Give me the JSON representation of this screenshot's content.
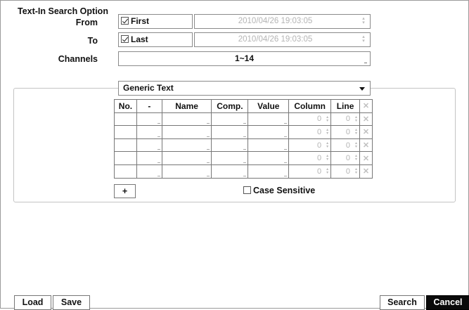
{
  "dialog": {
    "title": "Text-In Search Option"
  },
  "from": {
    "label": "From",
    "checkbox_label": "First",
    "checked": true,
    "datetime": "2010/04/26  19:03:05"
  },
  "to": {
    "label": "To",
    "checkbox_label": "Last",
    "checked": true,
    "datetime": "2010/04/26  19:03:05"
  },
  "channels": {
    "label": "Channels",
    "value": "1~14"
  },
  "device_type": {
    "selected": "Generic Text"
  },
  "table": {
    "headers": {
      "no": "No.",
      "dash": "-",
      "name": "Name",
      "comp": "Comp.",
      "value": "Value",
      "column": "Column",
      "line": "Line"
    },
    "rows": [
      {
        "column": "0",
        "line": "0"
      },
      {
        "column": "0",
        "line": "0"
      },
      {
        "column": "0",
        "line": "0"
      },
      {
        "column": "0",
        "line": "0"
      },
      {
        "column": "0",
        "line": "0"
      }
    ]
  },
  "add_button": {
    "label": "+"
  },
  "case_sensitive": {
    "label": "Case Sensitive",
    "checked": false
  },
  "buttons": {
    "load": "Load",
    "save": "Save",
    "search": "Search",
    "cancel": "Cancel"
  },
  "icons": {
    "remove": "close-x-icon",
    "spinner": "spinner-updown-icon",
    "dropdown": "chevron-down-icon"
  }
}
